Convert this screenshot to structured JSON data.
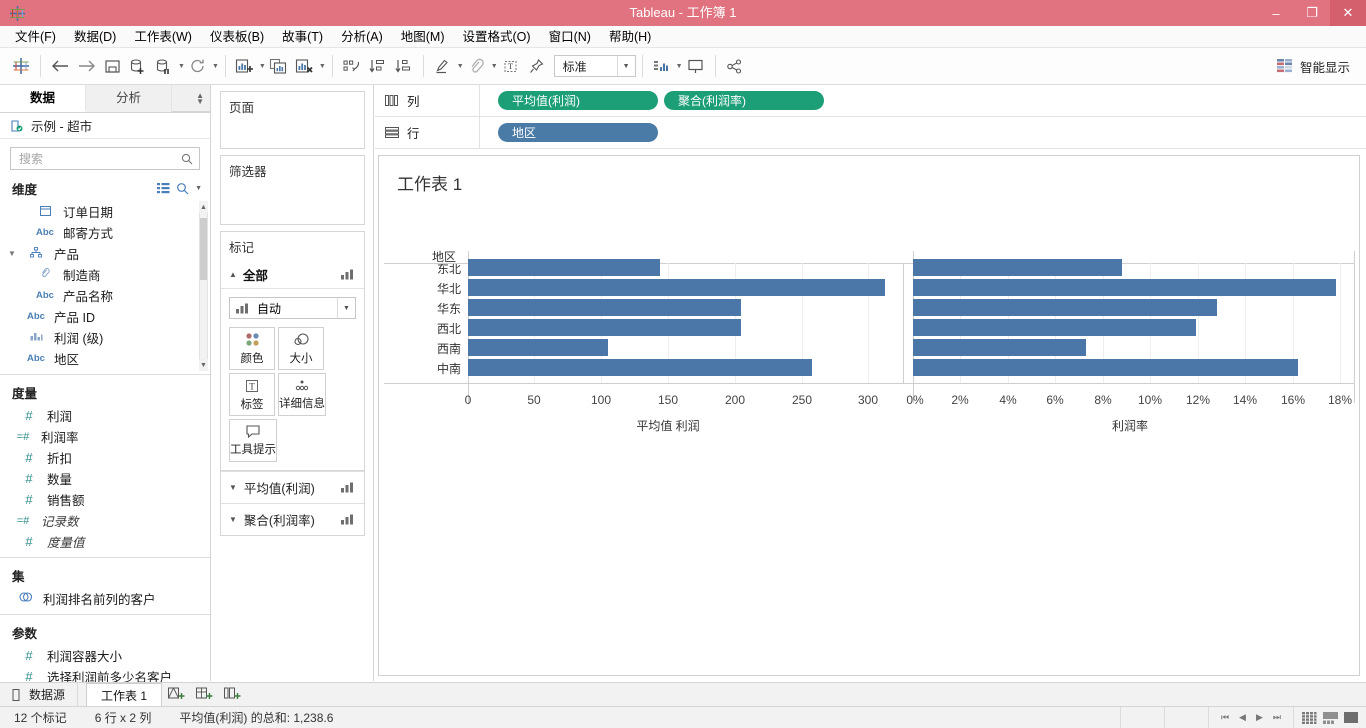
{
  "titlebar": {
    "app_title": "Tableau - 工作簿 1",
    "minimize": "–",
    "maximize": "❐",
    "close": "✕",
    "logo_icon": "tableau-logo-icon",
    "accent_color": "#e0737f"
  },
  "menubar": {
    "items": [
      {
        "label": "文件(F)"
      },
      {
        "label": "数据(D)"
      },
      {
        "label": "工作表(W)"
      },
      {
        "label": "仪表板(B)"
      },
      {
        "label": "故事(T)"
      },
      {
        "label": "分析(A)"
      },
      {
        "label": "地图(M)"
      },
      {
        "label": "设置格式(O)"
      },
      {
        "label": "窗口(N)"
      },
      {
        "label": "帮助(H)"
      }
    ]
  },
  "toolbar": {
    "fit_value": "标准",
    "show_me_label": "智能显示",
    "icons": [
      "tableau-home-icon",
      "back-arrow-icon",
      "forward-arrow-icon",
      "save-icon",
      "new-data-source-icon",
      "pause-refresh-icon",
      "refresh-icon",
      "new-worksheet-icon",
      "duplicate-sheet-icon",
      "clear-sheet-icon",
      "swap-rows-columns-icon",
      "sort-ascending-icon",
      "sort-descending-icon",
      "highlight-icon",
      "group-members-icon",
      "show-mark-labels-icon",
      "presentation-pin-icon",
      "fit-icon",
      "presentation-mode-icon",
      "share-icon"
    ]
  },
  "leftpane": {
    "tabs": [
      {
        "label": "数据",
        "active": true
      },
      {
        "label": "分析",
        "active": false
      }
    ],
    "datasource": {
      "label": "示例 - 超市",
      "icon": "data-source-icon"
    },
    "search": {
      "placeholder": "搜索",
      "icon": "search-icon"
    },
    "dimensions": {
      "title": "维度",
      "fields": [
        {
          "name": "订单日期",
          "type": "date",
          "typeglyph": "Ὄ5",
          "indent": 1
        },
        {
          "name": "邮寄方式",
          "type": "Abc",
          "indent": 1
        },
        {
          "name": "产品",
          "type": "hierarchy",
          "indent": 0,
          "expandable": true
        },
        {
          "name": "制造商",
          "type": "geo",
          "indent": 2
        },
        {
          "name": "产品名称",
          "type": "Abc",
          "indent": 2
        },
        {
          "name": "产品 ID",
          "type": "Abc",
          "indent": 0
        },
        {
          "name": "利润 (级)",
          "type": "bin",
          "indent": 0
        },
        {
          "name": "地区",
          "type": "Abc",
          "indent": 0
        }
      ]
    },
    "measures": {
      "title": "度量",
      "fields": [
        {
          "name": "利润",
          "type": "#",
          "italic": false
        },
        {
          "name": "利润率",
          "type": "=#",
          "italic": false
        },
        {
          "name": "折扣",
          "type": "#",
          "italic": false
        },
        {
          "name": "数量",
          "type": "#",
          "italic": false
        },
        {
          "name": "销售额",
          "type": "#",
          "italic": false
        },
        {
          "name": "记录数",
          "type": "=#",
          "italic": true
        },
        {
          "name": "度量值",
          "type": "#",
          "italic": true
        }
      ]
    },
    "sets": {
      "title": "集",
      "fields": [
        {
          "name": "利润排名前列的客户",
          "type": "set"
        }
      ]
    },
    "parameters": {
      "title": "参数",
      "fields": [
        {
          "name": "利润容器大小",
          "type": "#"
        },
        {
          "name": "选择利润前多少名客户",
          "type": "#"
        }
      ]
    }
  },
  "cards": {
    "pages_title": "页面",
    "filters_title": "筛选器",
    "marks_title": "标记",
    "marks_all": "全部",
    "marks_type": "自动",
    "buttons": [
      {
        "label": "颜色",
        "icon": "color-icon"
      },
      {
        "label": "大小",
        "icon": "size-icon"
      },
      {
        "label": "标签",
        "icon": "label-icon"
      },
      {
        "label": "详细信息",
        "icon": "detail-icon"
      },
      {
        "label": "工具提示",
        "icon": "tooltip-icon"
      }
    ],
    "sub_shelves": [
      {
        "label": "平均值(利润)"
      },
      {
        "label": "聚合(利润率)"
      }
    ]
  },
  "shelves": {
    "columns_label": "列",
    "rows_label": "行",
    "columns_pills": [
      {
        "label": "平均值(利润)",
        "color": "green"
      },
      {
        "label": "聚合(利润率)",
        "color": "green"
      }
    ],
    "rows_pills": [
      {
        "label": "地区",
        "color": "blue"
      }
    ]
  },
  "view": {
    "title": "工作表 1",
    "row_field_header": "地区"
  },
  "chart_data": [
    {
      "type": "bar",
      "orientation": "horizontal",
      "title": "平均值 利润",
      "xlabel": "平均值 利润",
      "ylabel": "地区",
      "categories": [
        "东北",
        "华北",
        "华东",
        "西北",
        "西南",
        "中南"
      ],
      "values": [
        144,
        313,
        205,
        205,
        105,
        258
      ],
      "xticks": [
        0,
        50,
        100,
        150,
        200,
        250,
        300
      ],
      "xticklabels": [
        "0",
        "50",
        "100",
        "150",
        "200",
        "250",
        "300"
      ],
      "xlim": [
        0,
        325
      ],
      "grid": true,
      "bar_color": "#4a76a8"
    },
    {
      "type": "bar",
      "orientation": "horizontal",
      "title": "利润率",
      "xlabel": "利润率",
      "ylabel": "地区",
      "categories": [
        "东北",
        "华北",
        "华东",
        "西北",
        "西南",
        "中南"
      ],
      "values": [
        8.8,
        17.8,
        12.8,
        11.9,
        7.3,
        16.2
      ],
      "xticks": [
        0,
        2,
        4,
        6,
        8,
        10,
        12,
        14,
        16,
        18
      ],
      "xticklabels": [
        "0%",
        "2%",
        "4%",
        "6%",
        "8%",
        "10%",
        "12%",
        "14%",
        "16%",
        "18%"
      ],
      "xlim": [
        0,
        18.4
      ],
      "grid": true,
      "bar_color": "#4a76a8"
    }
  ],
  "tabbar": {
    "datasource_tab": "数据源",
    "sheet_tab": "工作表 1",
    "new_worksheet_icon": "new-worksheet-tab-icon",
    "new_dashboard_icon": "new-dashboard-tab-icon",
    "new_story_icon": "new-story-tab-icon"
  },
  "statusbar": {
    "marks": "12 个标记",
    "dimensions": "6 行 x 2 列",
    "aggregate": "平均值(利润) 的总和: 1,238.6",
    "nav": [
      "⏮",
      "◀",
      "▶",
      "⏭"
    ]
  }
}
